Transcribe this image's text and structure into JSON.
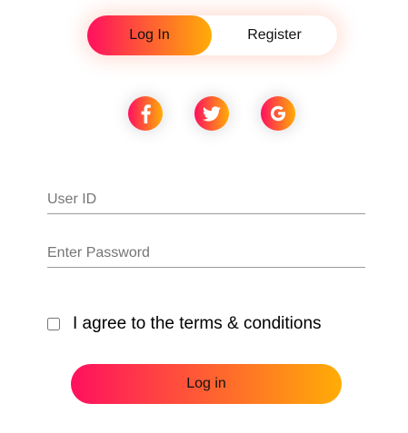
{
  "toggle": {
    "login_label": "Log In",
    "register_label": "Register",
    "active": "login"
  },
  "social": [
    {
      "name": "facebook",
      "icon": "facebook-icon"
    },
    {
      "name": "twitter",
      "icon": "twitter-icon"
    },
    {
      "name": "google",
      "icon": "google-icon"
    }
  ],
  "form": {
    "user_id": {
      "value": "",
      "placeholder": "User ID"
    },
    "password": {
      "value": "",
      "placeholder": "Enter Password"
    },
    "terms_label": "I agree to the terms & conditions",
    "terms_checked": false,
    "submit_label": "Log in"
  },
  "colors": {
    "gradient_start": "#ff105f",
    "gradient_end": "#ffad06"
  }
}
